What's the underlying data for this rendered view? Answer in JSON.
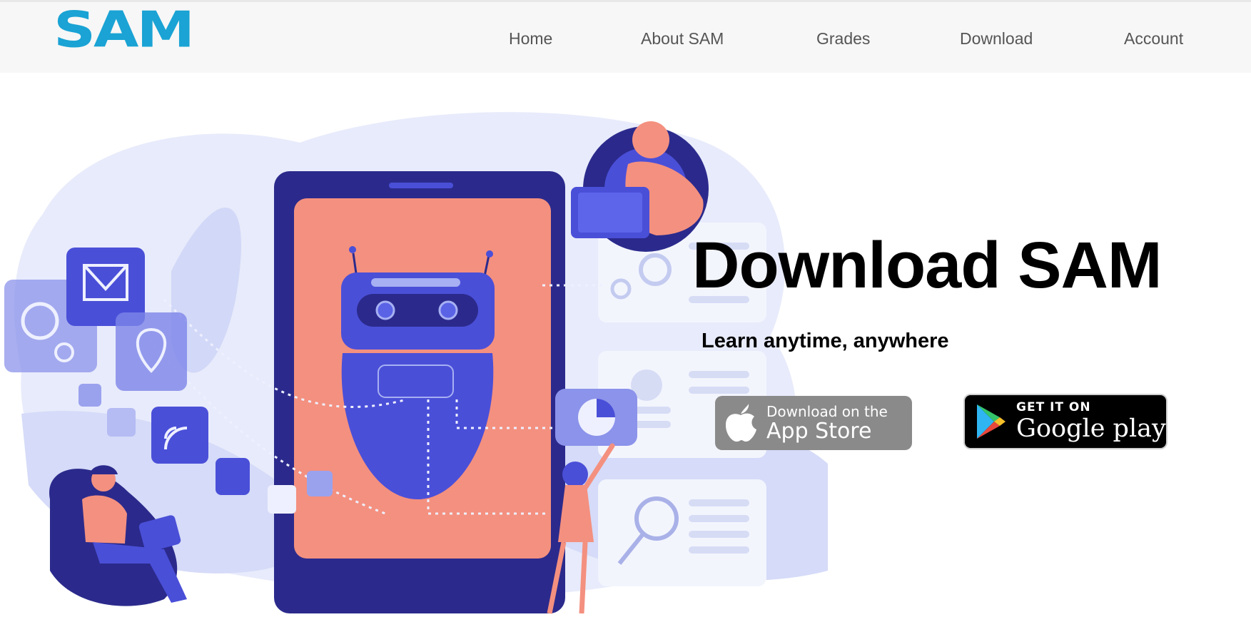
{
  "brand": {
    "logo_text": "SAM",
    "color": "#1aa3d4"
  },
  "nav": {
    "items": [
      {
        "label": "Home"
      },
      {
        "label": "About SAM"
      },
      {
        "label": "Grades"
      },
      {
        "label": "Download"
      },
      {
        "label": "Account"
      }
    ]
  },
  "hero": {
    "title": "Download SAM",
    "subtitle": "Learn anytime, anywhere",
    "illustration": "chatbot-tablet-illustration"
  },
  "badges": {
    "app_store": {
      "small": "Download on the",
      "big": "App Store",
      "icon": "apple-icon"
    },
    "google_play": {
      "small": "GET IT ON",
      "big": "Google play",
      "icon": "play-triangle-icon"
    }
  },
  "colors": {
    "accent_blue": "#4a4fd8",
    "navy": "#2b2a8c",
    "salmon": "#f4907f",
    "light_blue": "#e4e8fb"
  }
}
